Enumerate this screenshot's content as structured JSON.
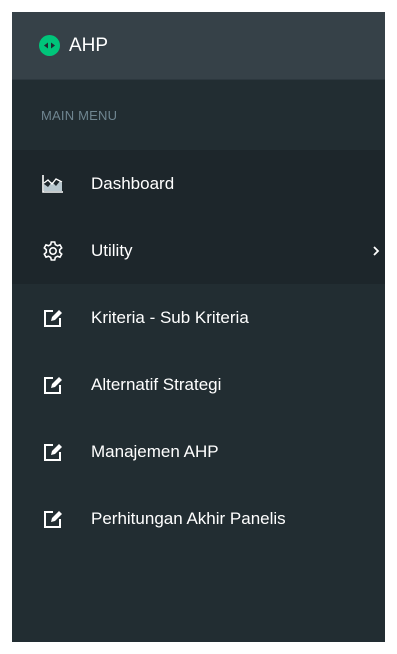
{
  "brand": {
    "title": "AHP",
    "logo_icon": "circle-arrows-logo-icon",
    "logo_color": "#00c57a"
  },
  "sidebar": {
    "section_header": "MAIN MENU",
    "items": [
      {
        "label": "Dashboard",
        "icon": "area-chart-icon"
      },
      {
        "label": "Utility",
        "icon": "gear-icon",
        "has_submenu": true
      },
      {
        "label": "Kriteria - Sub Kriteria",
        "icon": "edit-icon"
      },
      {
        "label": "Alternatif Strategi",
        "icon": "edit-icon"
      },
      {
        "label": "Manajemen AHP",
        "icon": "edit-icon"
      },
      {
        "label": "Perhitungan Akhir Panelis",
        "icon": "edit-icon"
      }
    ]
  },
  "colors": {
    "sidebar_bg": "#222d32",
    "header_bg": "#364148",
    "active_bg": "#1d262b",
    "section_text": "#6f8590",
    "text": "#ffffff"
  }
}
